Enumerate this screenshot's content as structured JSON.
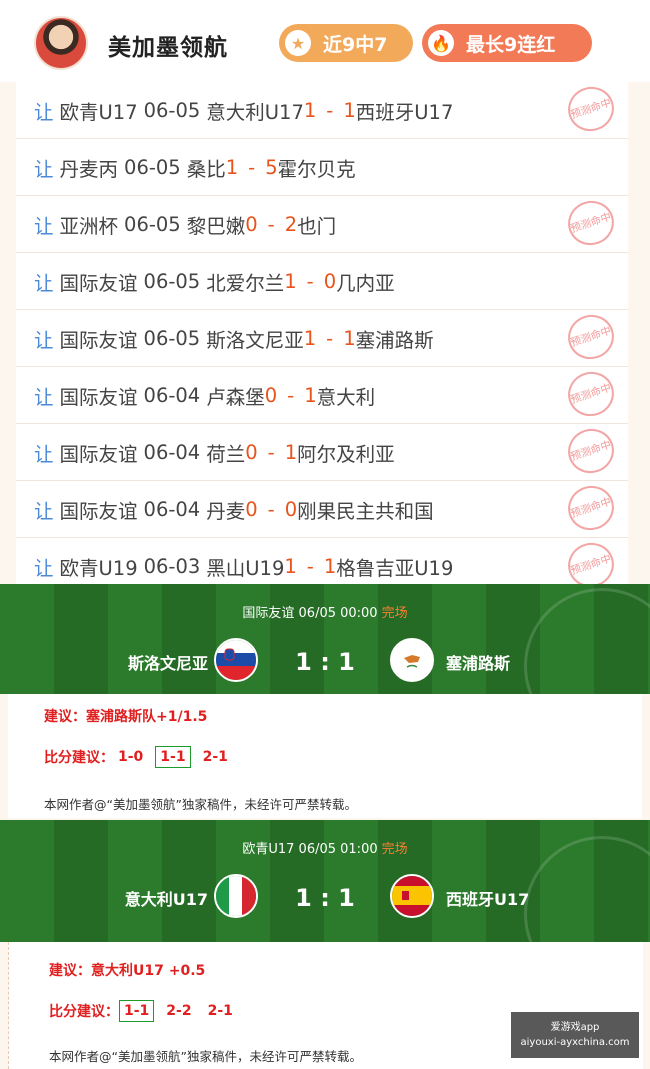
{
  "header": {
    "author": "美加墨领航",
    "badges": [
      {
        "label": "近9中7",
        "icon": "star-icon"
      },
      {
        "label": "最长9连红",
        "icon": "flame-icon"
      }
    ]
  },
  "results": [
    {
      "prefix": "让",
      "league": "欧青U17",
      "date": "06-05",
      "home": "意大利U17",
      "home_score": "1",
      "sep": "-",
      "away_score": "1",
      "away": "西班牙U17",
      "stamp": "预测命中"
    },
    {
      "prefix": "让",
      "league": "丹麦丙",
      "date": "06-05",
      "home": "桑比",
      "home_score": "1",
      "sep": "-",
      "away_score": "5",
      "away": "霍尔贝克",
      "stamp": ""
    },
    {
      "prefix": "让",
      "league": "亚洲杯",
      "date": "06-05",
      "home": "黎巴嫩",
      "home_score": "0",
      "sep": "-",
      "away_score": "2",
      "away": "也门",
      "stamp": "预测命中"
    },
    {
      "prefix": "让",
      "league": "国际友谊",
      "date": "06-05",
      "home": "北爱尔兰",
      "home_score": "1",
      "sep": "-",
      "away_score": "0",
      "away": "几内亚",
      "stamp": ""
    },
    {
      "prefix": "让",
      "league": "国际友谊",
      "date": "06-05",
      "home": "斯洛文尼亚",
      "home_score": "1",
      "sep": "-",
      "away_score": "1",
      "away": "塞浦路斯",
      "stamp": "预测命中"
    },
    {
      "prefix": "让",
      "league": "国际友谊",
      "date": "06-04",
      "home": "卢森堡",
      "home_score": "0",
      "sep": "-",
      "away_score": "1",
      "away": "意大利",
      "stamp": "预测命中"
    },
    {
      "prefix": "让",
      "league": "国际友谊",
      "date": "06-04",
      "home": "荷兰",
      "home_score": "0",
      "sep": "-",
      "away_score": "1",
      "away": "阿尔及利亚",
      "stamp": "预测命中"
    },
    {
      "prefix": "让",
      "league": "国际友谊",
      "date": "06-04",
      "home": "丹麦",
      "home_score": "0",
      "sep": "-",
      "away_score": "0",
      "away": "刚果民主共和国",
      "stamp": "预测命中"
    },
    {
      "prefix": "让",
      "league": "欧青U19",
      "date": "06-03",
      "home": "黑山U19",
      "home_score": "1",
      "sep": "-",
      "away_score": "1",
      "away": "格鲁吉亚U19",
      "stamp": "预测命中"
    }
  ],
  "cards": [
    {
      "meta": "国际友谊 06/05 00:00",
      "status": "完场",
      "home": "斯洛文尼亚",
      "away": "塞浦路斯",
      "score": "1 : 1",
      "home_flag": "slovenia-flag",
      "away_flag": "cyprus-flag",
      "advice": "建议：塞浦路斯队+1/1.5",
      "score_label": "比分建议：",
      "score_options": [
        "1-0",
        "1-1",
        "2-1"
      ],
      "selected": "1-1",
      "copyright": "本网作者@“美加墨领航”独家稿件，未经许可严禁转载。"
    },
    {
      "meta": "欧青U17 06/05 01:00",
      "status": "完场",
      "home": "意大利U17",
      "away": "西班牙U17",
      "score": "1 : 1",
      "home_flag": "italy-flag",
      "away_flag": "spain-flag",
      "advice": "建议：意大利U17  +0.5",
      "score_label": "比分建议：",
      "score_options": [
        "1-1",
        "2-2",
        "2-1"
      ],
      "selected": "1-1",
      "copyright": "本网作者@“美加墨领航”独家稿件，未经许可严禁转载。"
    }
  ],
  "watermark": {
    "line1": "爱游戏app",
    "line2": "aiyouxi-ayxchina.com"
  }
}
